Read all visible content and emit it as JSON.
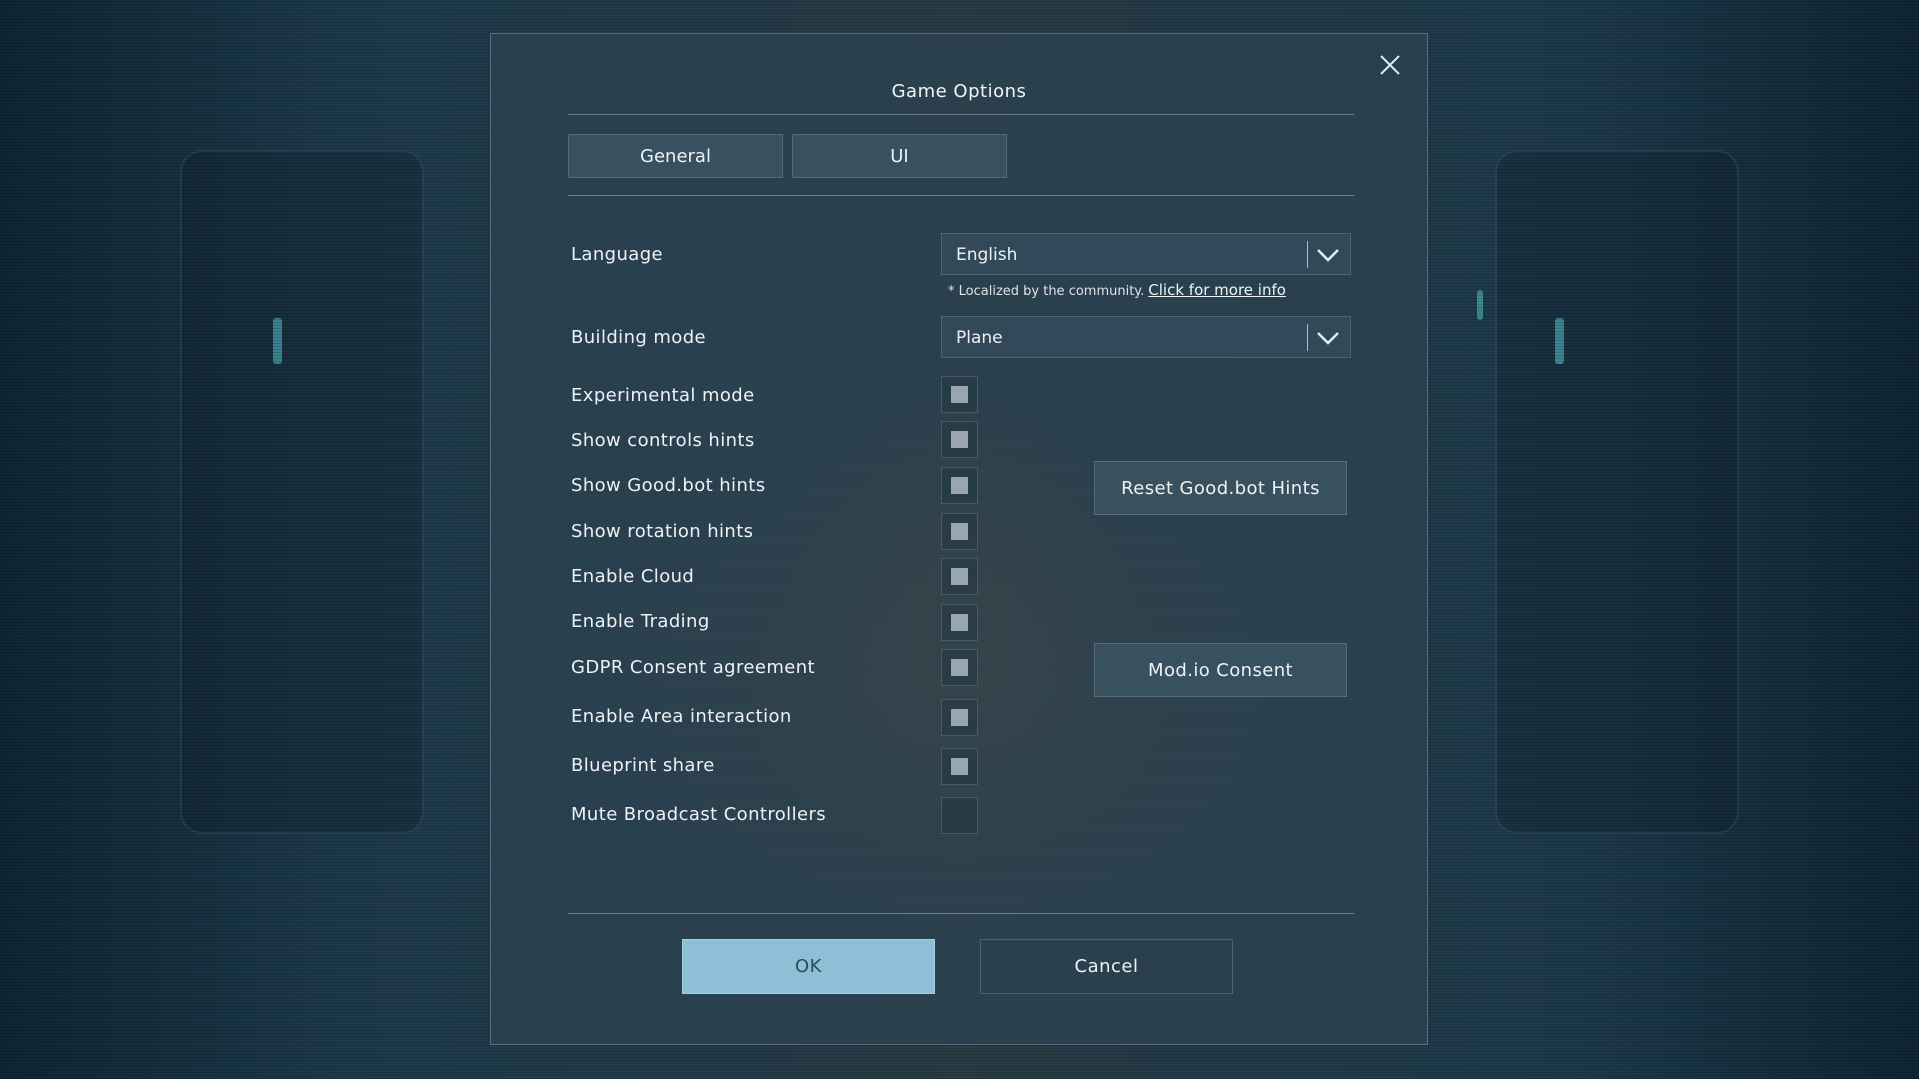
{
  "dialog": {
    "title": "Game Options",
    "tabs": [
      {
        "label": "General"
      },
      {
        "label": "UI"
      }
    ]
  },
  "settings": {
    "language": {
      "label": "Language",
      "value": "English"
    },
    "localization_note": {
      "text": "* Localized by the community.",
      "link": "Click for more info"
    },
    "building_mode": {
      "label": "Building mode",
      "value": "Plane"
    },
    "toggles": [
      {
        "label": "Experimental mode",
        "checked": true
      },
      {
        "label": "Show controls hints",
        "checked": true
      },
      {
        "label": "Show Good.bot hints",
        "checked": true
      },
      {
        "label": "Show rotation hints",
        "checked": true
      },
      {
        "label": "Enable Cloud",
        "checked": true
      },
      {
        "label": "Enable Trading",
        "checked": true
      },
      {
        "label": "GDPR Consent agreement",
        "checked": true
      },
      {
        "label": "Enable Area interaction",
        "checked": true
      },
      {
        "label": "Blueprint share",
        "checked": true
      },
      {
        "label": "Mute Broadcast Controllers",
        "checked": false
      }
    ],
    "reset_hints_button": "Reset Good.bot Hints",
    "modio_consent_button": "Mod.io Consent"
  },
  "footer": {
    "ok_label": "OK",
    "cancel_label": "Cancel"
  },
  "icons": {
    "close": "close-icon",
    "dropdown": "chevron-down-icon"
  },
  "colors": {
    "ok_button": "#8fbfd6",
    "panel": "#2b4250",
    "checkbox_fill": "#9aa6ad"
  }
}
